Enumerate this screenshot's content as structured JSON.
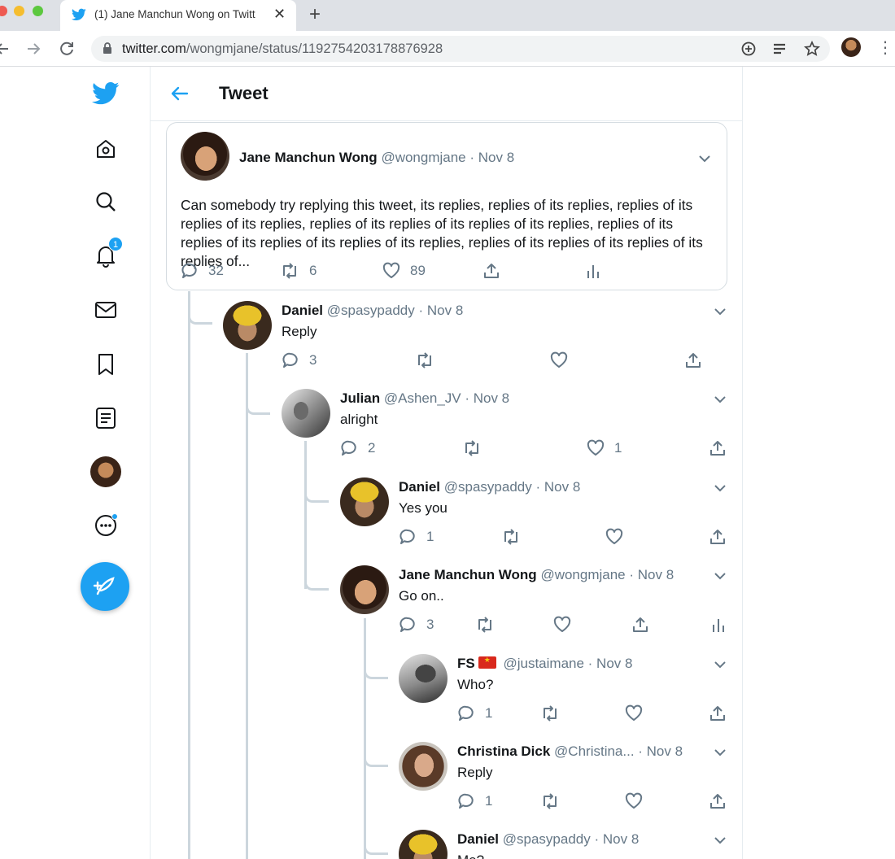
{
  "browser": {
    "tab_title": "(1) Jane Manchun Wong on Twitt",
    "url_host": "twitter.com",
    "url_path": "/wongmjane/status/1192754203178876928"
  },
  "sidebar": {
    "notification_count": "1",
    "items": [
      "home-icon",
      "search-icon",
      "bell-icon",
      "mail-icon",
      "bookmark-icon",
      "list-icon",
      "profile-avatar",
      "more-icon",
      "compose-icon"
    ]
  },
  "header": {
    "title": "Tweet"
  },
  "main_tweet": {
    "name": "Jane Manchun Wong",
    "handle": "@wongmjane · Nov 8",
    "text": "Can somebody try replying this tweet, its replies, replies of its replies, replies of its replies of its replies, replies of its replies of its replies of its replies, replies of its replies of its replies of its replies of its replies, replies of its replies of its replies of its replies of...",
    "replies": "32",
    "retweets": "6",
    "likes": "89"
  },
  "replies": [
    {
      "name": "Daniel",
      "handle": "@spasypaddy · Nov 8",
      "text": "Reply",
      "replies": "3",
      "likes": ""
    },
    {
      "name": "Julian",
      "handle": "@Ashen_JV · Nov 8",
      "text": "alright",
      "replies": "2",
      "likes": "1"
    },
    {
      "name": "Daniel",
      "handle": "@spasypaddy · Nov 8",
      "text": "Yes you",
      "replies": "1",
      "likes": ""
    },
    {
      "name": "Jane Manchun Wong",
      "handle": "@wongmjane · Nov 8",
      "text": "Go on..",
      "replies": "3",
      "likes": ""
    },
    {
      "name": "FS",
      "handle": "@justaimane · Nov 8",
      "text": "Who?",
      "replies": "1",
      "likes": ""
    },
    {
      "name": "Christina Dick",
      "handle": "@Christina... · Nov 8",
      "text": "Reply",
      "replies": "1",
      "likes": ""
    },
    {
      "name": "Daniel",
      "handle": "@spasypaddy · Nov 8",
      "text": "Me?",
      "replies": "",
      "likes": ""
    }
  ],
  "colors": {
    "accent": "#1da1f2",
    "muted": "#657786",
    "thread": "#ccd6dd"
  }
}
